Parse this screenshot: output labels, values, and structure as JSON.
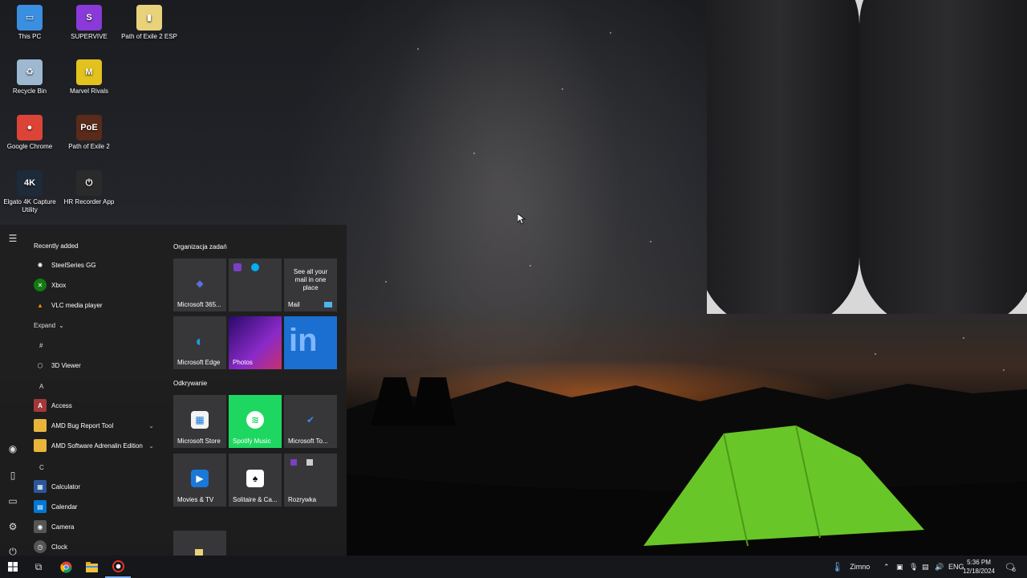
{
  "desktop": {
    "icons": [
      {
        "label": "This PC",
        "glyph": "▭",
        "color": "#3b8fe0"
      },
      {
        "label": "SUPERVIVE",
        "glyph": "S",
        "color": "#8a3ad8"
      },
      {
        "label": "Path of Exile 2 ESP",
        "glyph": "▮",
        "color": "#e8d27a"
      },
      {
        "label": "Recycle Bin",
        "glyph": "♻",
        "color": "#9db8d0"
      },
      {
        "label": "Marvel Rivals",
        "glyph": "M",
        "color": "#e3c21e"
      },
      {
        "label": "Google Chrome",
        "glyph": "●",
        "color": "#db4437"
      },
      {
        "label": "Path of Exile 2",
        "glyph": "PoE",
        "color": "#5a2a1a"
      },
      {
        "label": "Elgato 4K Capture Utility",
        "glyph": "4K",
        "color": "#1c2a3a"
      },
      {
        "label": "HR Recorder App",
        "glyph": "⏻",
        "color": "#2a2a2a"
      }
    ]
  },
  "start_menu": {
    "recently_added_label": "Recently added",
    "recent_apps": [
      {
        "label": "SteelSeries GG",
        "glyph": "✺",
        "color": "#444"
      },
      {
        "label": "Xbox",
        "glyph": "✕",
        "color": "#107c10"
      },
      {
        "label": "VLC media player",
        "glyph": "▲",
        "color": "#f08a00"
      }
    ],
    "expand_label": "Expand",
    "letters": [
      "#",
      "A",
      "C"
    ],
    "apps": [
      {
        "label": "3D Viewer",
        "glyph": "⬡",
        "color": "#333"
      },
      {
        "label": "Access",
        "glyph": "A",
        "color": "#a4373a"
      },
      {
        "label": "AMD Bug Report Tool",
        "glyph": "▬",
        "color": "#e8b53a"
      },
      {
        "label": "AMD Software Adrenalin Edition",
        "glyph": "▬",
        "color": "#e8b53a"
      },
      {
        "label": "Calculator",
        "glyph": "▦",
        "color": "#2b579a"
      },
      {
        "label": "Calendar",
        "glyph": "▤",
        "color": "#0078d4"
      },
      {
        "label": "Camera",
        "glyph": "◉",
        "color": "#555"
      },
      {
        "label": "Clock",
        "glyph": "◷",
        "color": "#555"
      }
    ],
    "group1_label": "Organizacja zadań",
    "group2_label": "Odkrywanie",
    "tiles": [
      {
        "label": "Microsoft 365...",
        "glyph": "◆",
        "bg": "rgba(60,60,64,0.85)",
        "ic": "#5a6fd8"
      },
      {
        "label": "",
        "glyph": "",
        "bg": "rgba(60,60,64,0.85)",
        "ic": "transparent"
      },
      {
        "label": "Mail",
        "glyph": "",
        "bg": "rgba(60,60,64,0.85)",
        "ic": "transparent"
      },
      {
        "label": "Microsoft Edge",
        "glyph": "◐",
        "bg": "rgba(60,60,64,0.85)",
        "ic": "#1fa0e0"
      },
      {
        "label": "Photos",
        "glyph": "",
        "bg": "#5a1fa8",
        "ic": "transparent"
      },
      {
        "label": "",
        "glyph": "in",
        "bg": "#1a6fd0",
        "ic": "transparent"
      },
      {
        "label": "Microsoft Store",
        "glyph": "▦",
        "bg": "rgba(60,60,64,0.85)",
        "ic": "#e8e8e8"
      },
      {
        "label": "Spotify Music",
        "glyph": "≋",
        "bg": "#1ed760",
        "ic": "#fff"
      },
      {
        "label": "Microsoft To...",
        "glyph": "✔",
        "bg": "rgba(60,60,64,0.85)",
        "ic": "transparent"
      },
      {
        "label": "Movies & TV",
        "glyph": "▶",
        "bg": "rgba(60,60,64,0.85)",
        "ic": "#1a78d8"
      },
      {
        "label": "Solitaire & Ca...",
        "glyph": "♠",
        "bg": "rgba(60,60,64,0.85)",
        "ic": "#fff"
      },
      {
        "label": "Rozrywka",
        "glyph": "",
        "bg": "rgba(60,60,64,0.85)",
        "ic": "transparent"
      }
    ],
    "mail_promo": "See all your mail in one place"
  },
  "taskbar": {
    "weather_label": "Zimno",
    "language": "ENG",
    "time": "5:36 PM",
    "date": "12/18/2024",
    "notification_count": "6"
  }
}
